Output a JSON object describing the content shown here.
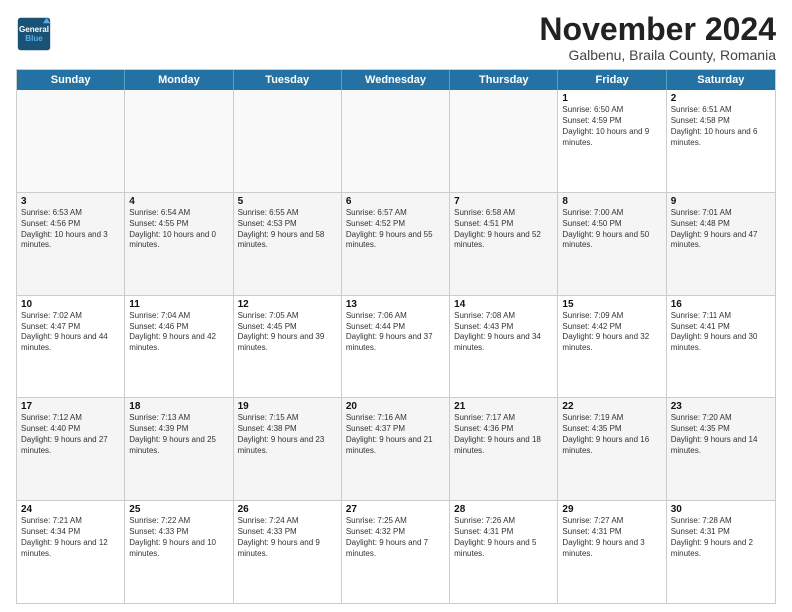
{
  "header": {
    "logo_line1": "General",
    "logo_line2": "Blue",
    "month": "November 2024",
    "location": "Galbenu, Braila County, Romania"
  },
  "weekdays": [
    "Sunday",
    "Monday",
    "Tuesday",
    "Wednesday",
    "Thursday",
    "Friday",
    "Saturday"
  ],
  "rows": [
    [
      {
        "day": "",
        "text": ""
      },
      {
        "day": "",
        "text": ""
      },
      {
        "day": "",
        "text": ""
      },
      {
        "day": "",
        "text": ""
      },
      {
        "day": "",
        "text": ""
      },
      {
        "day": "1",
        "text": "Sunrise: 6:50 AM\nSunset: 4:59 PM\nDaylight: 10 hours and 9 minutes."
      },
      {
        "day": "2",
        "text": "Sunrise: 6:51 AM\nSunset: 4:58 PM\nDaylight: 10 hours and 6 minutes."
      }
    ],
    [
      {
        "day": "3",
        "text": "Sunrise: 6:53 AM\nSunset: 4:56 PM\nDaylight: 10 hours and 3 minutes."
      },
      {
        "day": "4",
        "text": "Sunrise: 6:54 AM\nSunset: 4:55 PM\nDaylight: 10 hours and 0 minutes."
      },
      {
        "day": "5",
        "text": "Sunrise: 6:55 AM\nSunset: 4:53 PM\nDaylight: 9 hours and 58 minutes."
      },
      {
        "day": "6",
        "text": "Sunrise: 6:57 AM\nSunset: 4:52 PM\nDaylight: 9 hours and 55 minutes."
      },
      {
        "day": "7",
        "text": "Sunrise: 6:58 AM\nSunset: 4:51 PM\nDaylight: 9 hours and 52 minutes."
      },
      {
        "day": "8",
        "text": "Sunrise: 7:00 AM\nSunset: 4:50 PM\nDaylight: 9 hours and 50 minutes."
      },
      {
        "day": "9",
        "text": "Sunrise: 7:01 AM\nSunset: 4:48 PM\nDaylight: 9 hours and 47 minutes."
      }
    ],
    [
      {
        "day": "10",
        "text": "Sunrise: 7:02 AM\nSunset: 4:47 PM\nDaylight: 9 hours and 44 minutes."
      },
      {
        "day": "11",
        "text": "Sunrise: 7:04 AM\nSunset: 4:46 PM\nDaylight: 9 hours and 42 minutes."
      },
      {
        "day": "12",
        "text": "Sunrise: 7:05 AM\nSunset: 4:45 PM\nDaylight: 9 hours and 39 minutes."
      },
      {
        "day": "13",
        "text": "Sunrise: 7:06 AM\nSunset: 4:44 PM\nDaylight: 9 hours and 37 minutes."
      },
      {
        "day": "14",
        "text": "Sunrise: 7:08 AM\nSunset: 4:43 PM\nDaylight: 9 hours and 34 minutes."
      },
      {
        "day": "15",
        "text": "Sunrise: 7:09 AM\nSunset: 4:42 PM\nDaylight: 9 hours and 32 minutes."
      },
      {
        "day": "16",
        "text": "Sunrise: 7:11 AM\nSunset: 4:41 PM\nDaylight: 9 hours and 30 minutes."
      }
    ],
    [
      {
        "day": "17",
        "text": "Sunrise: 7:12 AM\nSunset: 4:40 PM\nDaylight: 9 hours and 27 minutes."
      },
      {
        "day": "18",
        "text": "Sunrise: 7:13 AM\nSunset: 4:39 PM\nDaylight: 9 hours and 25 minutes."
      },
      {
        "day": "19",
        "text": "Sunrise: 7:15 AM\nSunset: 4:38 PM\nDaylight: 9 hours and 23 minutes."
      },
      {
        "day": "20",
        "text": "Sunrise: 7:16 AM\nSunset: 4:37 PM\nDaylight: 9 hours and 21 minutes."
      },
      {
        "day": "21",
        "text": "Sunrise: 7:17 AM\nSunset: 4:36 PM\nDaylight: 9 hours and 18 minutes."
      },
      {
        "day": "22",
        "text": "Sunrise: 7:19 AM\nSunset: 4:35 PM\nDaylight: 9 hours and 16 minutes."
      },
      {
        "day": "23",
        "text": "Sunrise: 7:20 AM\nSunset: 4:35 PM\nDaylight: 9 hours and 14 minutes."
      }
    ],
    [
      {
        "day": "24",
        "text": "Sunrise: 7:21 AM\nSunset: 4:34 PM\nDaylight: 9 hours and 12 minutes."
      },
      {
        "day": "25",
        "text": "Sunrise: 7:22 AM\nSunset: 4:33 PM\nDaylight: 9 hours and 10 minutes."
      },
      {
        "day": "26",
        "text": "Sunrise: 7:24 AM\nSunset: 4:33 PM\nDaylight: 9 hours and 9 minutes."
      },
      {
        "day": "27",
        "text": "Sunrise: 7:25 AM\nSunset: 4:32 PM\nDaylight: 9 hours and 7 minutes."
      },
      {
        "day": "28",
        "text": "Sunrise: 7:26 AM\nSunset: 4:31 PM\nDaylight: 9 hours and 5 minutes."
      },
      {
        "day": "29",
        "text": "Sunrise: 7:27 AM\nSunset: 4:31 PM\nDaylight: 9 hours and 3 minutes."
      },
      {
        "day": "30",
        "text": "Sunrise: 7:28 AM\nSunset: 4:31 PM\nDaylight: 9 hours and 2 minutes."
      }
    ]
  ]
}
